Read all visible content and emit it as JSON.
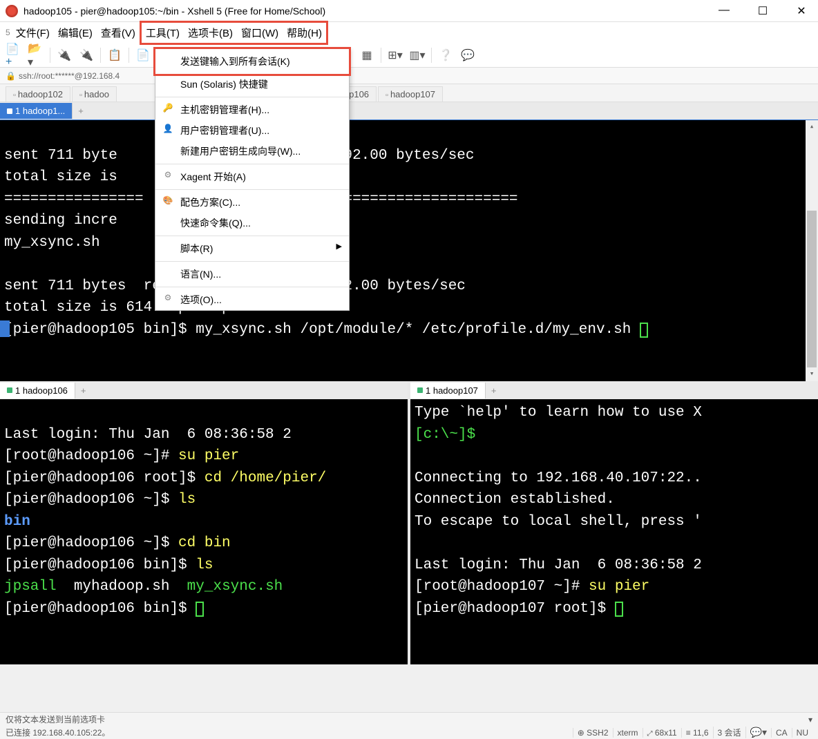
{
  "title": "hadoop105 - pier@hadoop105:~/bin - Xshell 5 (Free for Home/School)",
  "zoom": "5",
  "menu": {
    "file": "文件(F)",
    "edit": "编辑(E)",
    "view": "查看(V)",
    "tools": "工具(T)",
    "tabs": "选项卡(B)",
    "window": "窗口(W)",
    "help": "帮助(H)"
  },
  "dropdown": {
    "send_keys": "发送键输入到所有会话(K)",
    "sun": "Sun (Solaris) 快捷键",
    "host_key": "主机密钥管理者(H)...",
    "user_key": "用户密钥管理者(U)...",
    "new_key": "新建用户密钥生成向导(W)...",
    "xagent": "Xagent 开始(A)",
    "color": "配色方案(C)...",
    "quick": "快速命令集(Q)...",
    "script": "脚本(R)",
    "lang": "语言(N)...",
    "options": "选项(O)..."
  },
  "address": "ssh://root:******@192.168.4",
  "sessions": [
    "hadoop102",
    "hadoo",
    "hadoop106",
    "hadoop107"
  ],
  "top_pane_tab": "1 hadoop1...",
  "top_terminal": "\nsent 711 byte                  tes  1,492.00 bytes/sec\ntotal size is                  0.82\n================               ============================\nsending incre\nmy_xsync.sh\n\nsent 711 bytes  received 35 bytes  1,492.00 bytes/sec\ntotal size is 614  speedup is 0.82\n[pier@hadoop105 bin]$ my_xsync.sh /opt/module/* /etc/profile.d/my_env.sh ",
  "bl_tab": "1 hadoop106",
  "br_tab": "1 hadoop107",
  "bl_terminal": {
    "l1": "Last login: Thu Jan  6 08:36:58 2",
    "l2a": "[root@hadoop106 ~]# ",
    "l2b": "su pier",
    "l3a": "[pier@hadoop106 root]$ ",
    "l3b": "cd /home/pier/",
    "l4a": "[pier@hadoop106 ~]$ ",
    "l4b": "ls",
    "l5": "bin",
    "l6a": "[pier@hadoop106 ~]$ ",
    "l6b": "cd bin",
    "l7a": "[pier@hadoop106 bin]$ ",
    "l7b": "ls",
    "l8a": "jpsall",
    "l8b": "  myhadoop.sh  ",
    "l8c": "my_xsync.sh",
    "l9": "[pier@hadoop106 bin]$ "
  },
  "br_terminal": {
    "l1a": "Type `help' to learn how to use X",
    "l1b": "[c:\\~]$ ",
    "l2": "Connecting to 192.168.40.107:22..",
    "l3": "Connection established.",
    "l4": "To escape to local shell, press '",
    "l5": "Last login: Thu Jan  6 08:36:58 2",
    "l6a": "[root@hadoop107 ~]# ",
    "l6b": "su pier",
    "l7": "[pier@hadoop107 root]$ "
  },
  "status": {
    "hint": "仅将文本发送到当前选项卡",
    "conn": "已连接 192.168.40.105:22。",
    "ssh": "SSH2",
    "term": "xterm",
    "size": "68x11",
    "pos": "11,6",
    "sess": "3 会话",
    "caps": "CA",
    "num": "NU"
  }
}
